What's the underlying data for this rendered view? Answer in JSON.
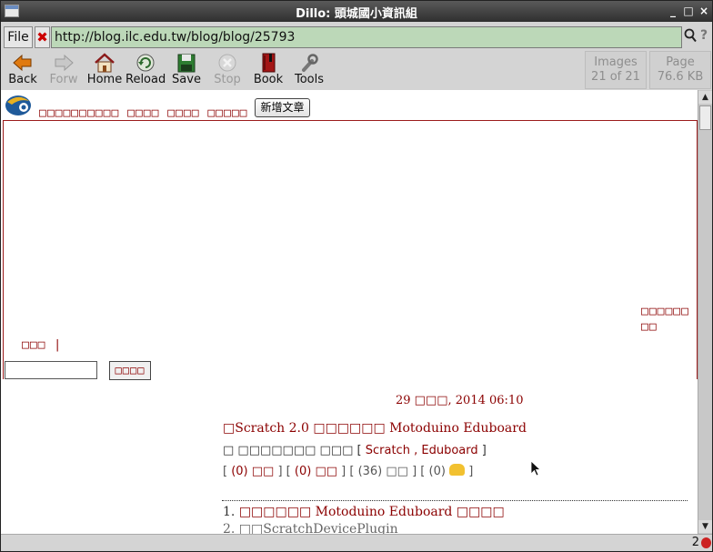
{
  "window": {
    "title": "Dillo: 頭城國小資訊組",
    "controls": [
      "_",
      "□",
      "×"
    ]
  },
  "urlbar": {
    "file_label": "File",
    "clear_label": "✖",
    "url": "http://blog.ilc.edu.tw/blog/blog/25793",
    "search_icon": "magnifier",
    "help_icon": "?"
  },
  "toolbar": {
    "back": "Back",
    "forward": "Forw",
    "home": "Home",
    "reload": "Reload",
    "save": "Save",
    "stop": "Stop",
    "book": "Book",
    "tools": "Tools",
    "images_label": "Images",
    "images_value": "21 of 21",
    "page_label": "Page",
    "page_value": "76.6 KB"
  },
  "page": {
    "site_name": "□□□□□□□□□□ □□□□ □□□□ □□□□□",
    "new_post_button": "新增文章",
    "side_links": "□□□□□□ □□",
    "category_link": "□□□ |",
    "search_submit": "□□□□",
    "post": {
      "date": "29 □□□, 2014 06:10",
      "title": "□Scratch 2.0 □□□□□□ Motoduino Eduboard",
      "meta_prefix": "□ □□□□□□□ □□□ [",
      "meta_tag1": "Scratch",
      "meta_sep": ",",
      "meta_tag2": "Eduboard",
      "meta_suffix": "]",
      "stat1": "(0) □□",
      "stat2": "(0) □□",
      "stat3": "(36) □□",
      "stat4": "(0)",
      "toc_item1_num": "1.",
      "toc_item1": "□□□□□□ Motoduino Eduboard □□□□",
      "toc_item2": "2. □□ScratchDevicePlugin"
    }
  },
  "statusbar": {
    "count": "2"
  }
}
